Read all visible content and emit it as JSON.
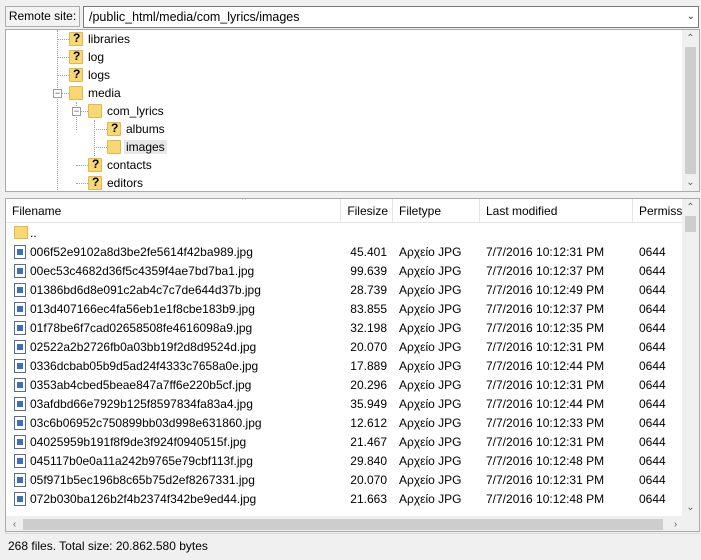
{
  "site_bar": {
    "label": "Remote site:",
    "path": "/public_html/media/com_lyrics/images"
  },
  "tree": {
    "nodes": [
      {
        "label": "libraries",
        "icon": "folder-question-icon"
      },
      {
        "label": "log",
        "icon": "folder-question-icon"
      },
      {
        "label": "logs",
        "icon": "folder-question-icon"
      },
      {
        "label": "media",
        "icon": "folder-icon",
        "expanded": true
      },
      {
        "label": "com_lyrics",
        "icon": "folder-icon",
        "expanded": true
      },
      {
        "label": "albums",
        "icon": "folder-question-icon"
      },
      {
        "label": "images",
        "icon": "folder-icon",
        "selected": true
      },
      {
        "label": "contacts",
        "icon": "folder-question-icon"
      },
      {
        "label": "editors",
        "icon": "folder-question-icon"
      }
    ]
  },
  "list": {
    "columns": [
      "Filename",
      "Filesize",
      "Filetype",
      "Last modified",
      "Permissi"
    ],
    "updir": "..",
    "rows": [
      {
        "name": "006f52e9102a8d3be2fe5614f42ba989.jpg",
        "size": "45.401",
        "type": "Αρχείο JPG",
        "modified": "7/7/2016 10:12:31 PM",
        "perm": "0644"
      },
      {
        "name": "00ec53c4682d36f5c4359f4ae7bd7ba1.jpg",
        "size": "99.639",
        "type": "Αρχείο JPG",
        "modified": "7/7/2016 10:12:37 PM",
        "perm": "0644"
      },
      {
        "name": "01386bd6d8e091c2ab4c7c7de644d37b.jpg",
        "size": "28.739",
        "type": "Αρχείο JPG",
        "modified": "7/7/2016 10:12:49 PM",
        "perm": "0644"
      },
      {
        "name": "013d407166ec4fa56eb1e1f8cbe183b9.jpg",
        "size": "83.855",
        "type": "Αρχείο JPG",
        "modified": "7/7/2016 10:12:37 PM",
        "perm": "0644"
      },
      {
        "name": "01f78be6f7cad02658508fe4616098a9.jpg",
        "size": "32.198",
        "type": "Αρχείο JPG",
        "modified": "7/7/2016 10:12:35 PM",
        "perm": "0644"
      },
      {
        "name": "02522a2b2726fb0a03bb19f2d8d9524d.jpg",
        "size": "20.070",
        "type": "Αρχείο JPG",
        "modified": "7/7/2016 10:12:31 PM",
        "perm": "0644"
      },
      {
        "name": "0336dcbab05b9d5ad24f4333c7658a0e.jpg",
        "size": "17.889",
        "type": "Αρχείο JPG",
        "modified": "7/7/2016 10:12:44 PM",
        "perm": "0644"
      },
      {
        "name": "0353ab4cbed5beae847a7ff6e220b5cf.jpg",
        "size": "20.296",
        "type": "Αρχείο JPG",
        "modified": "7/7/2016 10:12:31 PM",
        "perm": "0644"
      },
      {
        "name": "03afdbd66e7929b125f8597834fa83a4.jpg",
        "size": "35.949",
        "type": "Αρχείο JPG",
        "modified": "7/7/2016 10:12:44 PM",
        "perm": "0644"
      },
      {
        "name": "03c6b06952c750899bb03d998e631860.jpg",
        "size": "12.612",
        "type": "Αρχείο JPG",
        "modified": "7/7/2016 10:12:33 PM",
        "perm": "0644"
      },
      {
        "name": "04025959b191f8f9de3f924f0940515f.jpg",
        "size": "21.467",
        "type": "Αρχείο JPG",
        "modified": "7/7/2016 10:12:31 PM",
        "perm": "0644"
      },
      {
        "name": "045117b0e0a11a242b9765e79cbf113f.jpg",
        "size": "29.840",
        "type": "Αρχείο JPG",
        "modified": "7/7/2016 10:12:48 PM",
        "perm": "0644"
      },
      {
        "name": "05f971b5ec196b8c65b75d2ef8267331.jpg",
        "size": "20.070",
        "type": "Αρχείο JPG",
        "modified": "7/7/2016 10:12:31 PM",
        "perm": "0644"
      },
      {
        "name": "072b030ba126b2f4b2374f342be9ed44.jpg",
        "size": "21.663",
        "type": "Αρχείο JPG",
        "modified": "7/7/2016 10:12:48 PM",
        "perm": "0644"
      }
    ]
  },
  "status": "268 files. Total size: 20.862.580 bytes"
}
